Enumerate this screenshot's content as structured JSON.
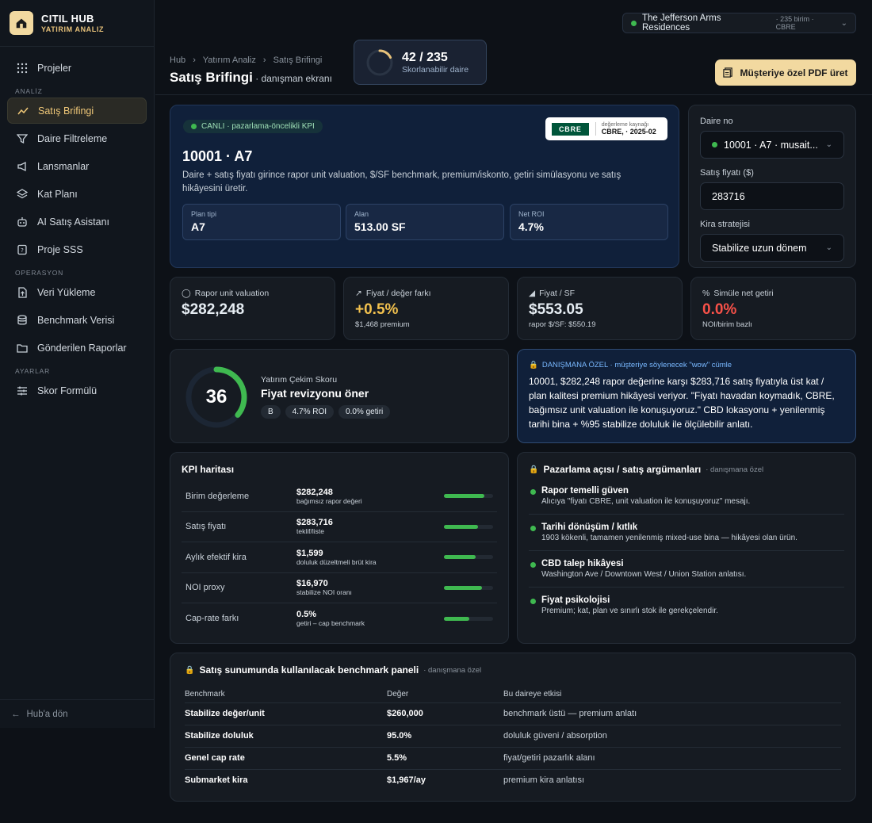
{
  "brand": {
    "name": "CITIL HUB",
    "sub": "YATIRIM ANALIZ"
  },
  "nav": {
    "projects": "Projeler",
    "section_analysis": "ANALİZ",
    "sales_briefing": "Satış Brifingi",
    "unit_filter": "Daire Filtreleme",
    "launches": "Lansmanlar",
    "floor_plan": "Kat Planı",
    "ai_assistant": "AI Satış Asistanı",
    "faq": "Proje SSS",
    "section_ops": "OPERASYON",
    "data_upload": "Veri Yükleme",
    "benchmark_data": "Benchmark Verisi",
    "sent_reports": "Gönderilen Raporlar",
    "section_settings": "AYARLAR",
    "score_formula": "Skor Formülü",
    "back": "Hub'a dön"
  },
  "header": {
    "project": "The Jefferson Arms Residences",
    "project_meta": " · 235 birim · CBRE",
    "crumbs": [
      "Hub",
      "Yatırım Analiz",
      "Satış Brifingi"
    ],
    "title": "Satış Brifingi",
    "subtitle": " · danışman ekranı",
    "score_count": "42 / 235",
    "score_label": "Skorlanabilir daire",
    "score_fraction": 0.179,
    "pdf_button": "Müşteriye özel PDF üret"
  },
  "hero": {
    "badge": "CANLI · pazarlama-öncelikli KPI",
    "source_label": "değerleme kaynağı",
    "source_value": "CBRE, · 2025-02",
    "logo": "CBRE",
    "title": "10001 · A7",
    "desc": "Daire + satış fiyatı girince rapor unit valuation, $/SF benchmark, premium/iskonto, getiri simülasyonu ve satış hikâyesini üretir.",
    "plan_label": "Plan tipi",
    "plan_value": "A7",
    "area_label": "Alan",
    "area_value": "513.00 SF",
    "roi_label": "Net ROI",
    "roi_value": "4.7%"
  },
  "form": {
    "unit_label": "Daire no",
    "unit_value": "10001 · A7 · musait...",
    "price_label": "Satış fiyatı ($)",
    "price_value": "283716",
    "strategy_label": "Kira stratejisi",
    "strategy_value": "Stabilize uzun dönem"
  },
  "kpis": {
    "valuation_label": "Rapor unit valuation",
    "valuation_value": "$282,248",
    "gap_label": "Fiyat / değer farkı",
    "gap_value": "+0.5%",
    "gap_sub": "$1,468 premium",
    "psf_label": "Fiyat / SF",
    "psf_value": "$553.05",
    "psf_sub": "rapor $/SF: $550.19",
    "yield_label": "Simüle net getiri",
    "yield_value": "0.0%",
    "yield_sub": "NOI/birim bazlı"
  },
  "score": {
    "value": "36",
    "fraction": 0.36,
    "label": "Yatırım Çekim Skoru",
    "title": "Fiyat revizyonu öner",
    "chips": [
      "B",
      "4.7% ROI",
      "0.0% getiri"
    ]
  },
  "wow": {
    "header": "DANIŞMANA ÖZEL · müşteriye söylenecek \"wow\" cümle",
    "text": "10001, $282,248 rapor değerine karşı $283,716 satış fiyatıyla üst kat / plan kalitesi premium hikâyesi veriyor. \"Fiyatı havadan koymadık, CBRE, bağımsız unit valuation ile konuşuyoruz.\" CBD lokasyonu + yenilenmiş tarihi bina + %95 stabilize doluluk ile ölçülebilir anlatı."
  },
  "kpi_map": {
    "title": "KPI haritası",
    "rows": [
      {
        "name": "Birim değerleme",
        "value": "$282,248",
        "sub": "bağımsız rapor değeri",
        "fill": 0.82
      },
      {
        "name": "Satış fiyatı",
        "value": "$283,716",
        "sub": "teklif/liste",
        "fill": 0.7
      },
      {
        "name": "Aylık efektif kira",
        "value": "$1,599",
        "sub": "doluluk düzeltmeli brüt kira",
        "fill": 0.64
      },
      {
        "name": "NOI proxy",
        "value": "$16,970",
        "sub": "stabilize NOI oranı",
        "fill": 0.77
      },
      {
        "name": "Cap-rate farkı",
        "value": "0.5%",
        "sub": "getiri – cap benchmark",
        "fill": 0.52
      }
    ]
  },
  "args": {
    "title": "Pazarlama açısı / satış argümanları",
    "tag": "· danışmana özel",
    "items": [
      {
        "title": "Rapor temelli güven",
        "desc": "Alıcıya \"fiyatı CBRE, unit valuation ile konuşuyoruz\" mesajı."
      },
      {
        "title": "Tarihi dönüşüm / kıtlık",
        "desc": "1903 kökenli, tamamen yenilenmiş mixed-use bina — hikâyesi olan ürün."
      },
      {
        "title": "CBD talep hikâyesi",
        "desc": "Washington Ave / Downtown West / Union Station anlatısı."
      },
      {
        "title": "Fiyat psikolojisi",
        "desc": "Premium; kat, plan ve sınırlı stok ile gerekçelendir."
      }
    ]
  },
  "bench": {
    "title": "Satış sunumunda kullanılacak benchmark paneli",
    "tag": "· danışmana özel",
    "headers": [
      "Benchmark",
      "Değer",
      "Bu daireye etkisi"
    ],
    "rows": [
      [
        "Stabilize değer/unit",
        "$260,000",
        "benchmark üstü — premium anlatı"
      ],
      [
        "Stabilize doluluk",
        "95.0%",
        "doluluk güveni / absorption"
      ],
      [
        "Genel cap rate",
        "5.5%",
        "fiyat/getiri pazarlık alanı"
      ],
      [
        "Submarket kira",
        "$1,967/ay",
        "premium kira anlatısı"
      ]
    ]
  },
  "colors": {
    "accent": "#f2d9a0",
    "positive": "#3fb950",
    "warning": "#f2c14e",
    "negative": "#f85149",
    "info": "#79b8ff"
  }
}
